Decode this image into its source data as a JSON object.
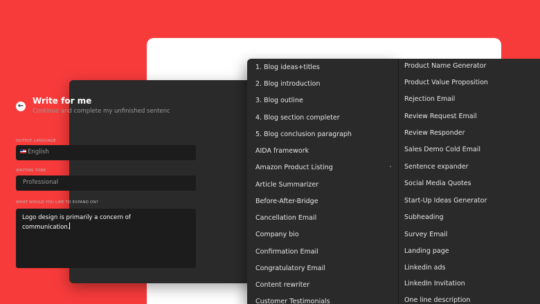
{
  "panel": {
    "title": "Write for me",
    "subtitle": "Continue and complete my unfinished sentenc",
    "output_language_label": "OUTPUT LANGUAGE",
    "output_language_value": "English",
    "writing_tone_label": "WRITING TONE",
    "writing_tone_value": "Professional",
    "expand_label": "WHAT WOULD YOU LIKE TO EXPAND ON?",
    "expand_value": "Logo design is primarily a concern of communication."
  },
  "menu_left": [
    "1. Blog ideas+titles",
    "2. Blog introduction",
    "3. Blog outline",
    "4. Blog section completer",
    "5. Blog conclusion paragraph",
    "AIDA framework",
    "Amazon Product Listing",
    "Article Summarizer",
    "Before-After-Bridge",
    "Cancellation Email",
    "Company bio",
    "Confirmation Email",
    "Congratulatory Email",
    "Content rewriter",
    "Customer Testimonials"
  ],
  "menu_right": [
    "Product Name Generator",
    "Product Value Proposition",
    "Rejection Email",
    "Review Request Email",
    "Review Responder",
    "Sales Demo Cold Email",
    "Sentence expander",
    "Social Media Quotes",
    "Start-Up Ideas Generator",
    "Subheading",
    "Survey Email",
    "Landing page",
    "Linkedin ads",
    "LinkedIn Invitation",
    "One line description"
  ]
}
